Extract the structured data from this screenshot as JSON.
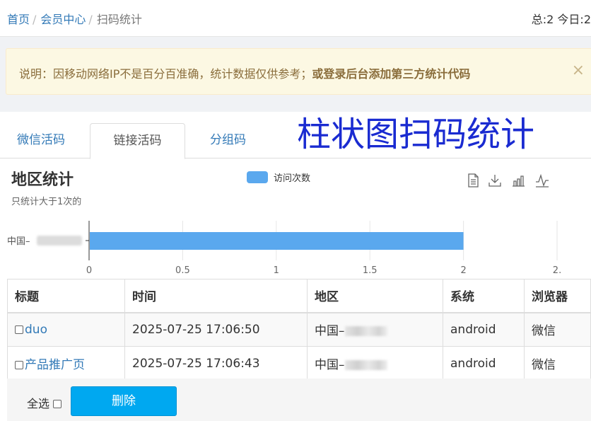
{
  "breadcrumb": {
    "home": "首页",
    "member": "会员中心",
    "current": "扫码统计",
    "separator": "/"
  },
  "stats_text": "总:2 今日:2",
  "notice": {
    "text": "说明：因移动网络IP不是百分百准确，统计数据仅供参考；",
    "bold_link": "或登录后台添加第三方统计代码",
    "close": "×"
  },
  "tabs": [
    {
      "label": "微信活码",
      "active": false
    },
    {
      "label": "链接活码",
      "active": true
    },
    {
      "label": "分组码",
      "active": false
    }
  ],
  "overlay_text": "柱状图扫码统计",
  "chart_header": {
    "title": "地区统计",
    "subtitle": "只统计大于1次的"
  },
  "toolbox": [
    "data-view-icon",
    "download-icon",
    "bar-chart-icon",
    "line-chart-icon"
  ],
  "chart_data": {
    "type": "bar",
    "orientation": "horizontal",
    "title": "地区统计",
    "subtitle": "只统计大于1次的",
    "categories": [
      "中国–"
    ],
    "series": [
      {
        "name": "访问次数",
        "values": [
          2
        ],
        "color": "#5aa8ee"
      }
    ],
    "xticks": [
      "0",
      "0.5",
      "1",
      "1.5",
      "2",
      "2."
    ],
    "xlim": [
      0,
      2.5
    ],
    "grid": true,
    "legend": "top-center"
  },
  "table": {
    "headers": [
      "标题",
      "时间",
      "地区",
      "系统",
      "浏览器"
    ],
    "rows": [
      {
        "title": "duo",
        "time": "2025-07-25 17:06:50",
        "region": "中国–",
        "os": "android",
        "browser": "微信"
      },
      {
        "title": "产品推广页",
        "time": "2025-07-25 17:06:43",
        "region": "中国–",
        "os": "android",
        "browser": "微信"
      }
    ]
  },
  "footer": {
    "select_all": "全选",
    "delete": "删除"
  }
}
